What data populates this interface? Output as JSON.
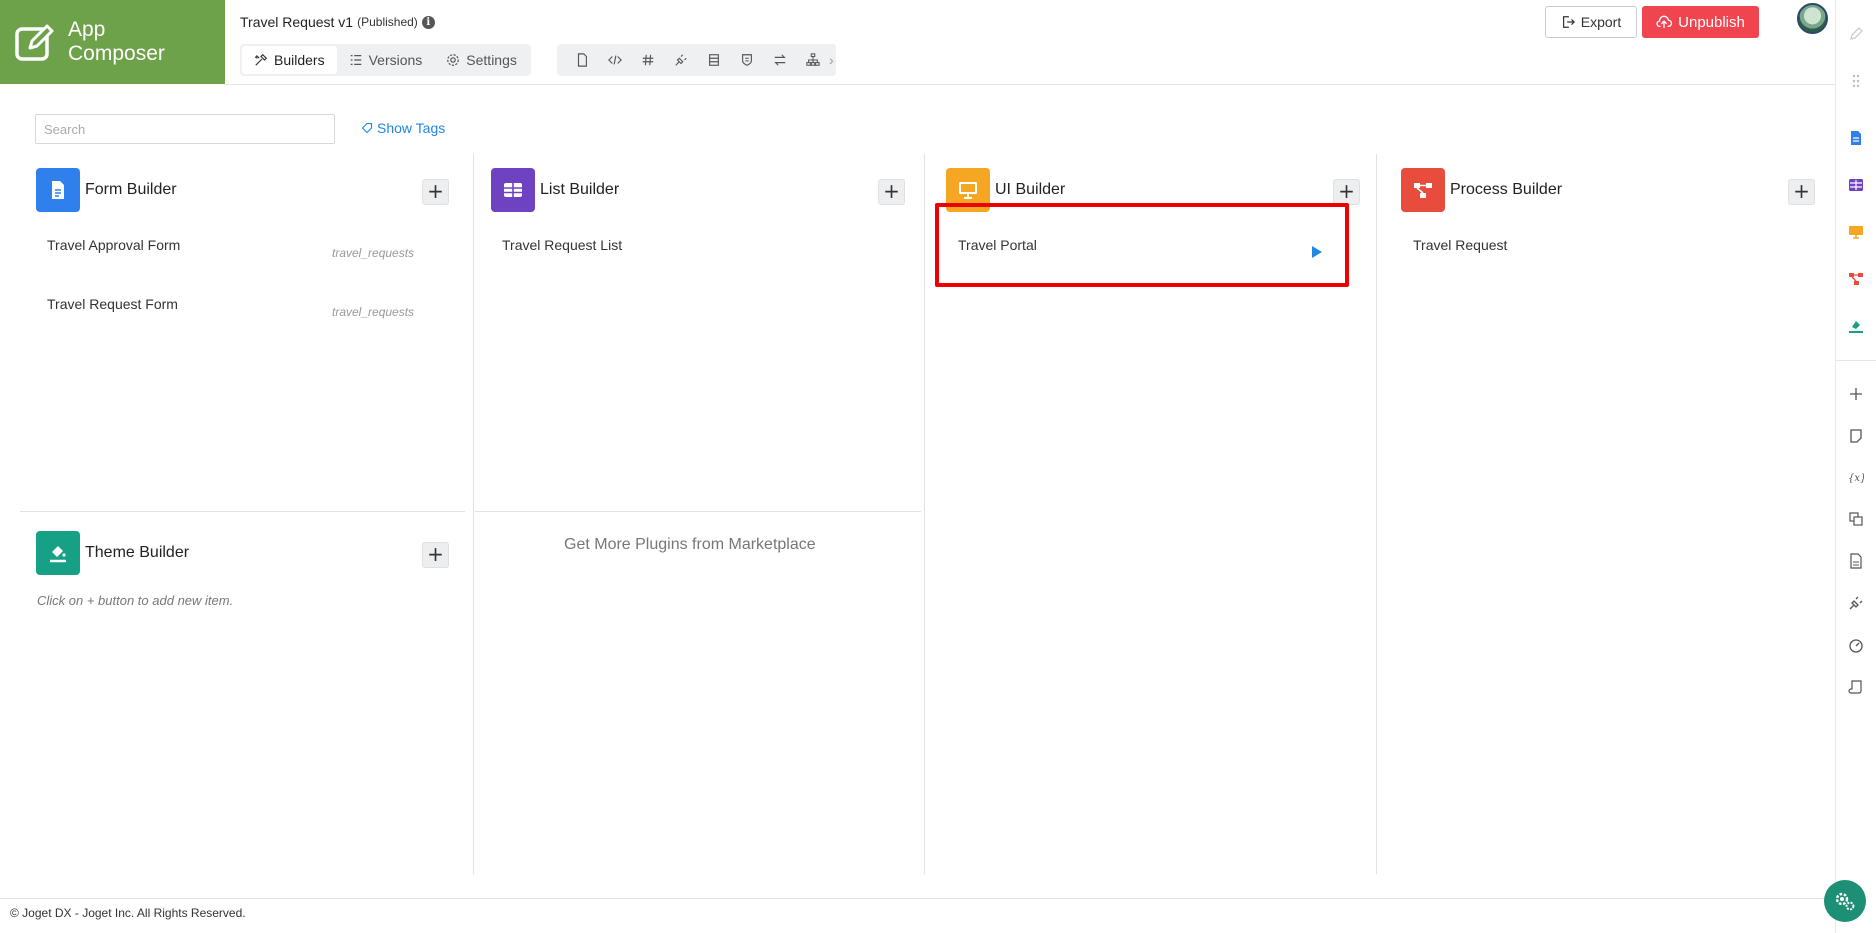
{
  "app": {
    "logo_text_line1": "App",
    "logo_text_line2": "Composer",
    "title": "Travel Request v1",
    "status": "(Published)"
  },
  "nav": {
    "tabs": [
      {
        "label": "Builders",
        "active": true
      },
      {
        "label": "Versions",
        "active": false
      },
      {
        "label": "Settings",
        "active": false
      }
    ],
    "tool_icons": [
      "file-icon",
      "code-icon",
      "hash-icon",
      "plugin-icon",
      "table-icon",
      "shield-icon",
      "swap-icon",
      "sitemap-icon"
    ],
    "more_glyph": "›"
  },
  "actions": {
    "export_label": "Export",
    "unpublish_label": "Unpublish"
  },
  "search": {
    "placeholder": "Search"
  },
  "show_tags_label": "Show Tags",
  "builders": {
    "form": {
      "title": "Form Builder",
      "items": [
        {
          "name": "Travel Approval Form",
          "tag": "travel_requests"
        },
        {
          "name": "Travel Request Form",
          "tag": "travel_requests"
        }
      ]
    },
    "list": {
      "title": "List Builder",
      "items": [
        {
          "name": "Travel Request List"
        }
      ]
    },
    "ui": {
      "title": "UI Builder",
      "items": [
        {
          "name": "Travel Portal"
        }
      ]
    },
    "process": {
      "title": "Process Builder",
      "items": [
        {
          "name": "Travel Request"
        }
      ]
    },
    "theme": {
      "title": "Theme Builder",
      "empty_note": "Click on + button to add new item."
    }
  },
  "add_glyph": "+",
  "marketplace_label": "Get More Plugins from Marketplace",
  "footer": "© Joget DX - Joget Inc. All Rights Reserved.",
  "colors": {
    "brand_green": "#6da24a",
    "form_blue": "#2f80ed",
    "list_purple": "#6f42c1",
    "ui_yellow": "#f5a623",
    "process_red": "#e74c3c",
    "theme_teal": "#16a085",
    "unpublish_red": "#f0444f",
    "link_blue": "#1e88e5"
  }
}
